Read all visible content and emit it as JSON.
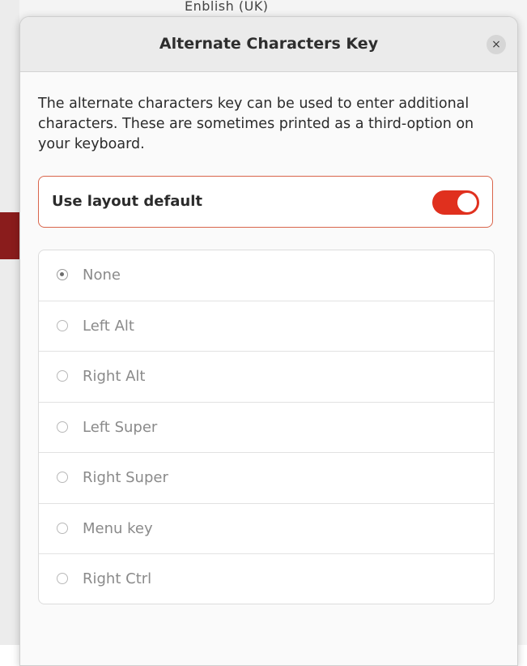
{
  "background": {
    "partial_title": "Enblish (UK)"
  },
  "dialog": {
    "title": "Alternate Characters Key",
    "close_icon": "×",
    "description": "The alternate characters key can be used to enter additional characters. These are sometimes printed as a third-option on your keyboard.",
    "layout_default": {
      "label": "Use layout default",
      "enabled": true
    },
    "options": [
      {
        "label": "None",
        "selected": true
      },
      {
        "label": "Left Alt",
        "selected": false
      },
      {
        "label": "Right Alt",
        "selected": false
      },
      {
        "label": "Left Super",
        "selected": false
      },
      {
        "label": "Right Super",
        "selected": false
      },
      {
        "label": "Menu key",
        "selected": false
      },
      {
        "label": "Right Ctrl",
        "selected": false
      }
    ]
  },
  "colors": {
    "accent": "#e0301e",
    "focus_border": "#d9654b"
  }
}
